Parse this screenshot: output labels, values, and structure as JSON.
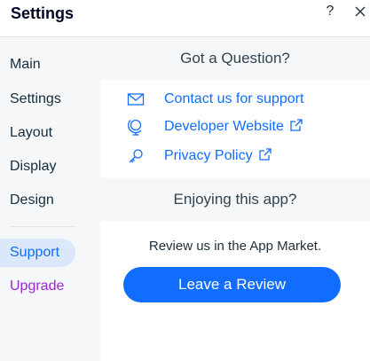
{
  "header": {
    "title": "Settings",
    "help_label": "?",
    "close_icon": "close-icon"
  },
  "sidebar": {
    "items": [
      {
        "label": "Main"
      },
      {
        "label": "Settings"
      },
      {
        "label": "Layout"
      },
      {
        "label": "Display"
      },
      {
        "label": "Design"
      },
      {
        "label": "Support",
        "active": true
      },
      {
        "label": "Upgrade"
      }
    ],
    "active_color": "#116dff",
    "upgrade_color": "#9a27d5"
  },
  "support": {
    "question_heading": "Got a Question?",
    "links": [
      {
        "label": "Contact us for support",
        "icon": "mail-icon"
      },
      {
        "label": "Developer Website",
        "icon": "globe-icon",
        "external": true
      },
      {
        "label": "Privacy Policy",
        "icon": "key-icon",
        "external": true
      }
    ],
    "enjoy_heading": "Enjoying this app?",
    "review_prompt": "Review us in the App Market.",
    "review_button": "Leave a Review"
  },
  "colors": {
    "accent": "#116dff",
    "sidebar_bg": "#f5f7f9",
    "active_bg": "#dbe8fb"
  }
}
